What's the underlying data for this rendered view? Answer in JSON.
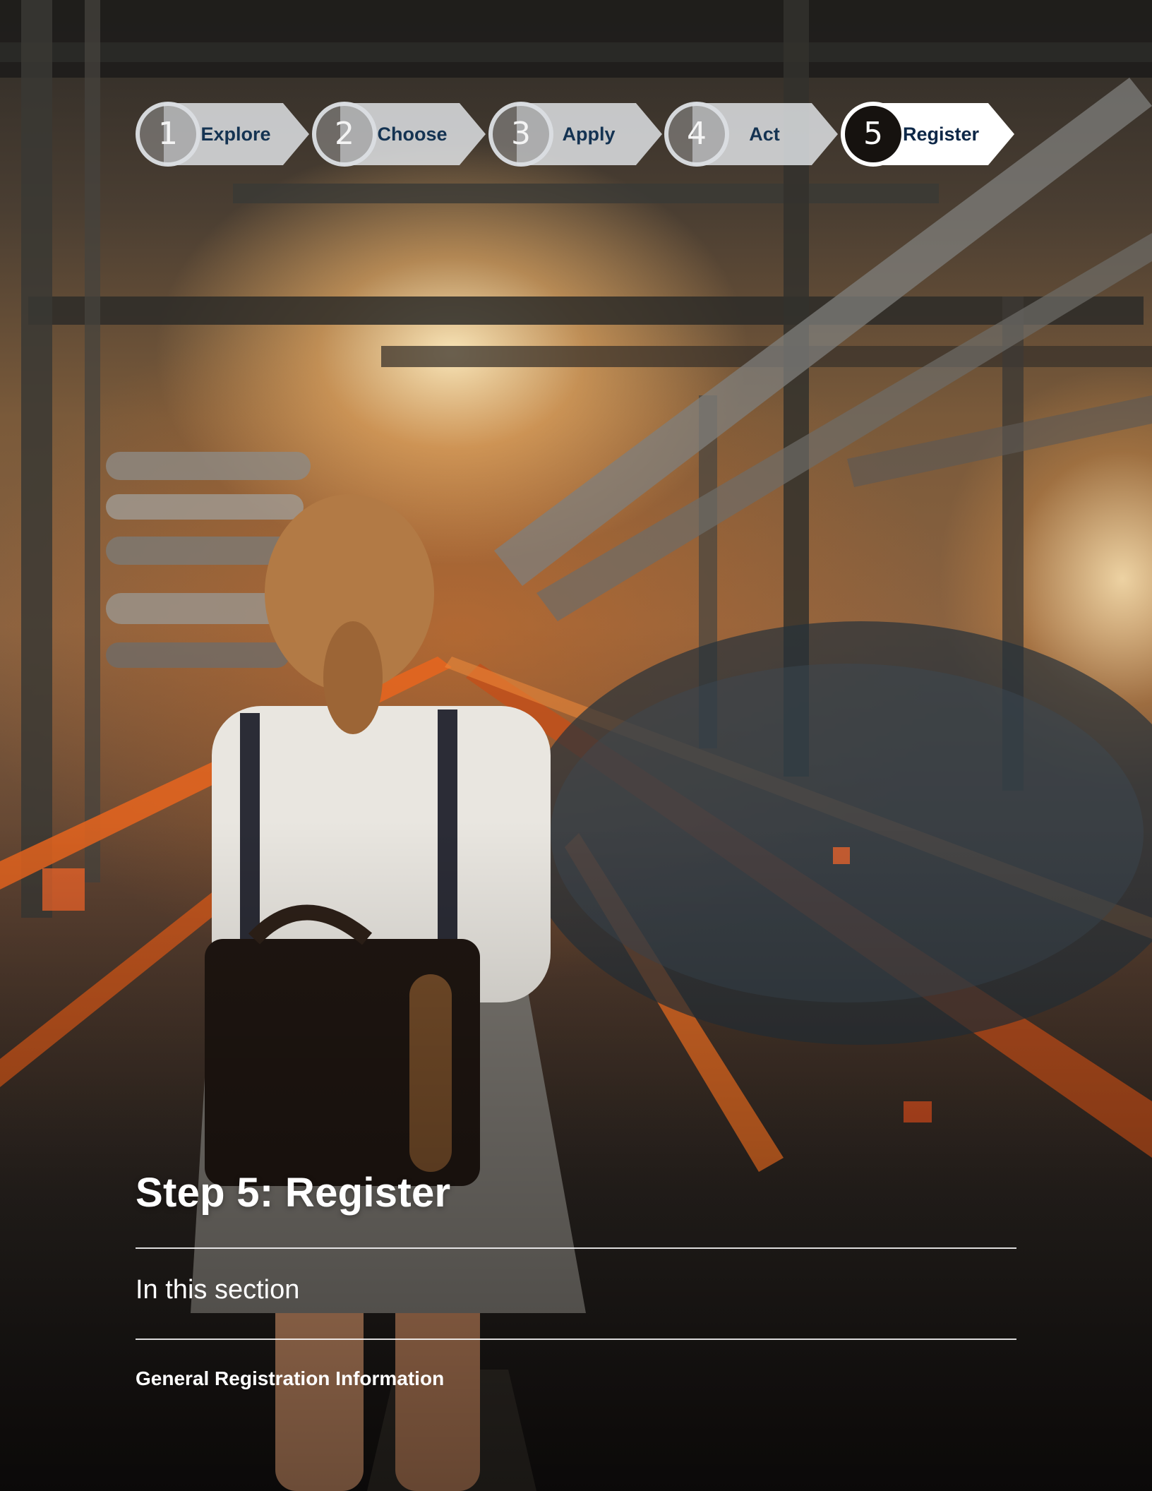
{
  "steps": [
    {
      "number": "1",
      "label": "Explore",
      "active": false
    },
    {
      "number": "2",
      "label": "Choose",
      "active": false
    },
    {
      "number": "3",
      "label": "Apply",
      "active": false
    },
    {
      "number": "4",
      "label": "Act",
      "active": false
    },
    {
      "number": "5",
      "label": "Register",
      "active": true
    }
  ],
  "heading": "Step 5: Register",
  "section_intro": "In this section",
  "contents": [
    "General Registration Information"
  ],
  "colors": {
    "active_step": "#16120f",
    "step_label": "#143352",
    "accent_orange": "#e8651f"
  }
}
